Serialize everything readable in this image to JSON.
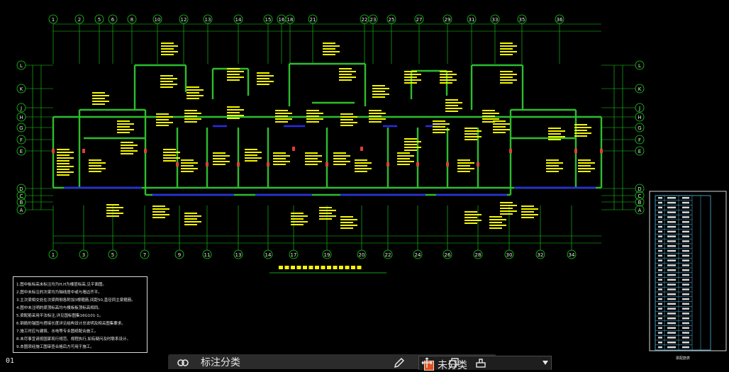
{
  "drawing": {
    "background": "#000000",
    "grid_color": "#19d419",
    "top_axes": [
      "1",
      "2",
      "5",
      "6",
      "8",
      "10",
      "12",
      "13",
      "14",
      "15",
      "16",
      "18",
      "21",
      "22",
      "23",
      "25",
      "27",
      "29",
      "31",
      "33",
      "35",
      "36"
    ],
    "bottom_axes": [
      "1",
      "3",
      "5",
      "7",
      "9",
      "11",
      "13",
      "14",
      "17",
      "19",
      "20",
      "22",
      "24",
      "26",
      "28",
      "30",
      "32",
      "34"
    ],
    "left_axes": [
      "L",
      "K",
      "J",
      "H",
      "G",
      "F",
      "E",
      "D",
      "C",
      "B",
      "A"
    ],
    "right_axes": [
      "L",
      "K",
      "J",
      "H",
      "G",
      "F",
      "E",
      "D",
      "C",
      "B",
      "A"
    ],
    "title_color": "#f4f400",
    "column_color": "#e23b3b",
    "beam_color": "#2a2ae8"
  },
  "notes": {
    "lines": [
      "1.图中板标高未标注均为H,H为楼层标高,见平面图。",
      "2.图中未标注的次梁均为轴线居中或与墙边齐平。",
      "3.主次梁相交处在次梁两侧各附加3根箍筋,间距50,直径同主梁箍筋。",
      "4.图中未注明的梁顶标高均与楼板板顶标高相同。",
      "5.梁配筋采用平法标注,详见国标图集16G101-1。",
      "6.钢筋的锚固与搭接长度详见结构设计总说明及相关图集要求。",
      "7.施工时应与建筑、水电等专业图纸配合施工。",
      "8.未尽事宜请按国家现行规范、规程执行,如有疑问及时联系设计。",
      "9.本图须经施工图审查合格后方可用于施工。"
    ]
  },
  "legend": {
    "title": "梁配筋表"
  },
  "sheet_tab": {
    "label": "01"
  },
  "toolbar": {
    "category_label": "标注分类",
    "dropdown_value": "未分类",
    "swatch_color": "#e0501e",
    "icons": [
      "link-icon",
      "edit-icon",
      "move-icon",
      "copy-icon",
      "stamp-icon"
    ]
  }
}
